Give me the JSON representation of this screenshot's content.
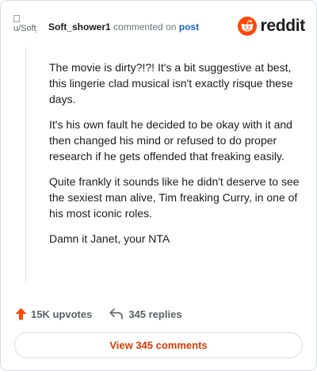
{
  "header": {
    "avatar_alt": "u/Soft_",
    "username": "Soft_shower1",
    "action_text": "commented on",
    "post_link": "post",
    "logo_text": "reddit"
  },
  "comment": {
    "paragraphs": [
      "The movie is dirty?!?! It's a bit suggestive at best, this lingerie clad musical isn't exactly risque these days.",
      "It's his own fault he decided to be okay with it and then changed his mind or refused to do proper research if he gets offended that freaking easily.",
      "Quite frankly it sounds like he didn't deserve to see the sexiest man alive, Tim freaking Curry, in one of his most iconic roles.",
      "Damn it Janet, your NTA"
    ]
  },
  "footer": {
    "upvotes": "15K upvotes",
    "replies": "345 replies",
    "upvote_icon": "upvote-arrow-icon",
    "reply_icon": "reply-arrow-icon"
  },
  "view_comments_label": "View 345 comments",
  "colors": {
    "brand": "#ff4500",
    "link": "#1a63c7",
    "view_comments": "#d93a00",
    "muted": "#5a6266"
  }
}
